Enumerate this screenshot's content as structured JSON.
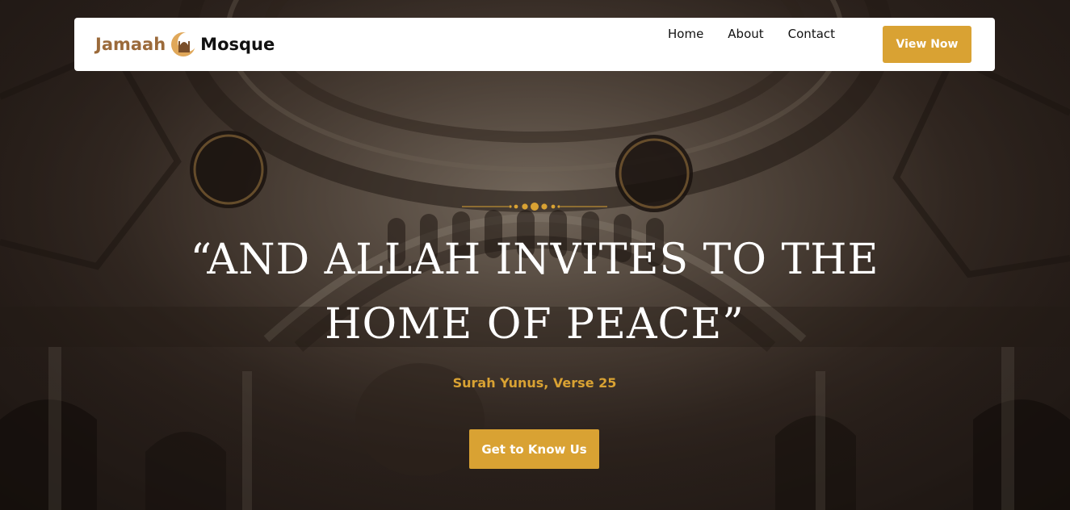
{
  "brand": {
    "name_part1": "Jamaah",
    "name_part2": "Mosque",
    "logo_icon": "crescent-mosque-icon"
  },
  "nav": {
    "links": [
      "Home",
      "About",
      "Contact"
    ],
    "cta_label": "View Now"
  },
  "hero": {
    "headline": "“AND ALLAH INVITES TO THE HOME OF PEACE”",
    "subtitle": "Surah Yunus, Verse 25",
    "cta_label": "Get to Know Us",
    "divider_icon": "ornament-divider-icon",
    "background": "mosque-dome-interior-image"
  },
  "colors": {
    "accent": "#d9a233",
    "brand_brown": "#9b6a3a",
    "nav_bg": "#ffffff",
    "text_dark": "#111111",
    "headline": "#ffffff"
  }
}
